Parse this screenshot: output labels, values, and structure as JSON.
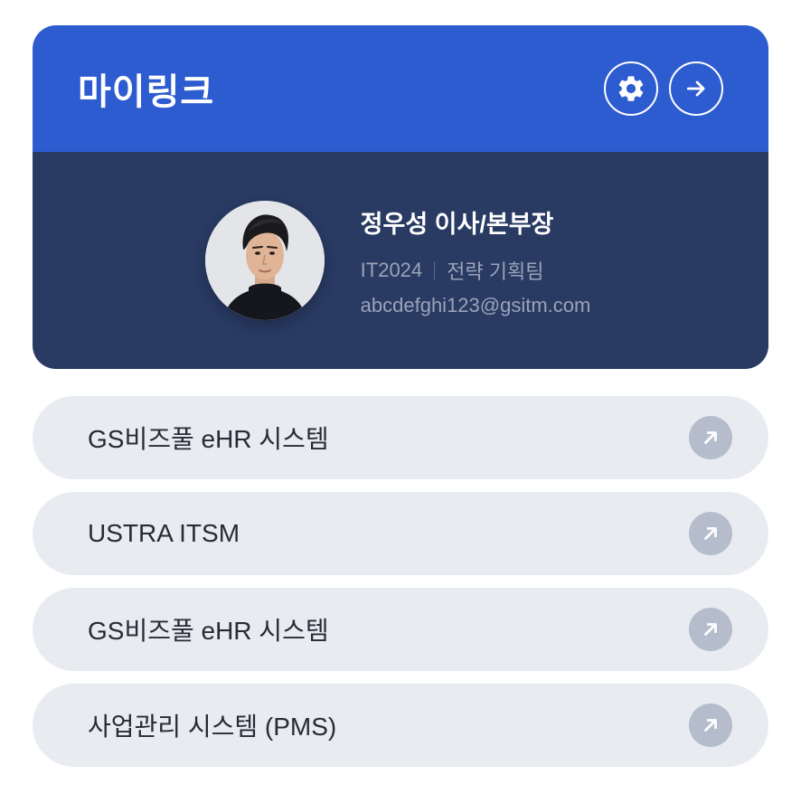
{
  "header": {
    "title": "마이링크",
    "settings_icon": "gear-icon",
    "go_icon": "arrow-right-icon",
    "accent_color": "#2d5bd0"
  },
  "profile": {
    "name": "정우성 이사/본부장",
    "code": "IT2024",
    "team": "전략 기획팀",
    "email": "abcdefghi123@gsitm.com",
    "panel_color": "#293a63"
  },
  "links": [
    {
      "label": "GS비즈풀 eHR 시스템",
      "icon": "arrow-up-right-icon"
    },
    {
      "label": "USTRA ITSM",
      "icon": "arrow-up-right-icon"
    },
    {
      "label": "GS비즈풀 eHR 시스템",
      "icon": "arrow-up-right-icon"
    },
    {
      "label": "사업관리 시스템 (PMS)",
      "icon": "arrow-up-right-icon"
    }
  ]
}
